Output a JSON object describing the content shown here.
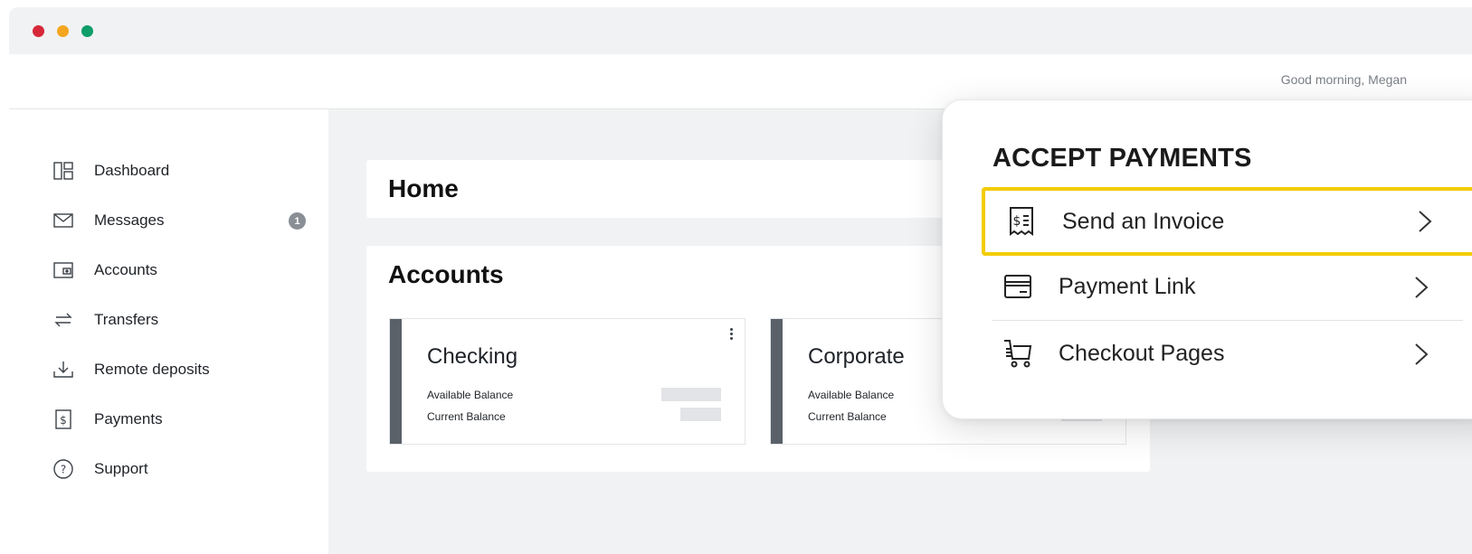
{
  "window": {
    "controls": [
      "close",
      "minimize",
      "maximize"
    ]
  },
  "topbar": {
    "greeting": "Good morning, Megan"
  },
  "sidebar": {
    "items": [
      {
        "label": "Dashboard",
        "icon": "dashboard-icon"
      },
      {
        "label": "Messages",
        "icon": "mail-icon",
        "badge": "1"
      },
      {
        "label": "Accounts",
        "icon": "wallet-icon"
      },
      {
        "label": "Transfers",
        "icon": "transfer-icon"
      },
      {
        "label": "Remote deposits",
        "icon": "download-icon"
      },
      {
        "label": "Payments",
        "icon": "dollar-receipt-icon"
      },
      {
        "label": "Support",
        "icon": "help-icon"
      }
    ]
  },
  "main": {
    "home_title": "Home",
    "accounts_title": "Accounts",
    "accounts": [
      {
        "name": "Checking",
        "available_label": "Available Balance",
        "current_label": "Current Balance"
      },
      {
        "name": "Corporate",
        "available_label": "Available Balance",
        "current_label": "Current Balance"
      }
    ]
  },
  "popup": {
    "title": "ACCEPT PAYMENTS",
    "items": [
      {
        "label": "Send an Invoice",
        "icon": "invoice-icon",
        "selected": true
      },
      {
        "label": "Payment Link",
        "icon": "card-icon",
        "selected": false
      },
      {
        "label": "Checkout Pages",
        "icon": "cart-icon",
        "selected": false
      }
    ],
    "highlight_colors": [
      "#f2cc00",
      "#f2a400"
    ]
  },
  "colors": {
    "accent_bar": "#5a6169",
    "background": "#f1f2f3"
  }
}
